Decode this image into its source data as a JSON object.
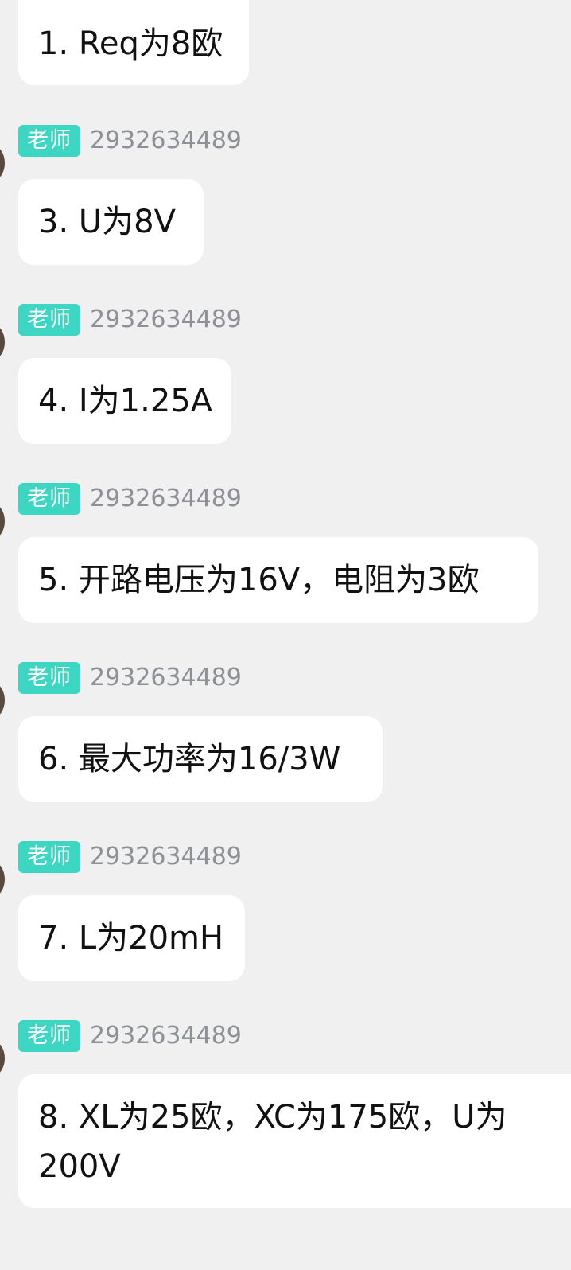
{
  "messages": [
    {
      "role": "",
      "id": "",
      "text": "1. Req为8欧"
    },
    {
      "role": "老师",
      "id": "2932634489",
      "text": "3. U为8V"
    },
    {
      "role": "老师",
      "id": "2932634489",
      "text": "4. I为1.25A"
    },
    {
      "role": "老师",
      "id": "2932634489",
      "text": "5. 开路电压为16V，电阻为3欧"
    },
    {
      "role": "老师",
      "id": "2932634489",
      "text": "6. 最大功率为16/3W"
    },
    {
      "role": "老师",
      "id": "2932634489",
      "text": "7. L为20mH"
    },
    {
      "role": "老师",
      "id": "2932634489",
      "text": "8. XL为25欧，XC为175欧，U为200V"
    }
  ],
  "colors": {
    "badge": "#3dd6c3",
    "background": "#f0f0f0",
    "bubble": "#ffffff"
  }
}
